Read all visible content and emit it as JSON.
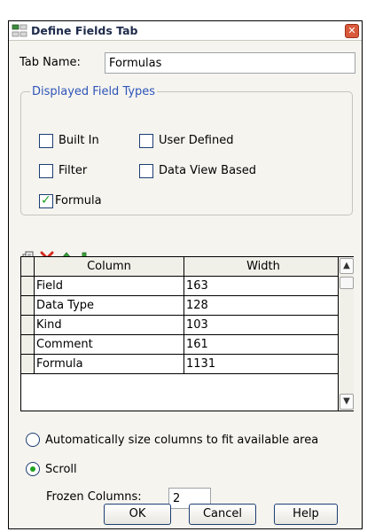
{
  "window": {
    "title": "Define Fields Tab",
    "close_glyph": "✕"
  },
  "tab_name": {
    "label": "Tab Name:",
    "value": "Formulas"
  },
  "field_types": {
    "legend": "Displayed Field Types",
    "options": [
      {
        "label": "Built In",
        "checked": false
      },
      {
        "label": "User Defined",
        "checked": false
      },
      {
        "label": "Filter",
        "checked": false
      },
      {
        "label": "Data View Based",
        "checked": false
      },
      {
        "label": "Formula",
        "checked": true
      }
    ]
  },
  "toolbar": {
    "icons": [
      "properties-icon",
      "delete-icon",
      "move-up-icon",
      "move-down-icon"
    ]
  },
  "grid": {
    "columns": [
      "Column",
      "Width"
    ],
    "rows": [
      [
        "Field",
        "163"
      ],
      [
        "Data Type",
        "128"
      ],
      [
        "Kind",
        "103"
      ],
      [
        "Comment",
        "161"
      ],
      [
        "Formula",
        "1131"
      ]
    ]
  },
  "sizing": {
    "auto_label": "Automatically size columns to fit available area",
    "scroll_label": "Scroll",
    "selected": "scroll",
    "frozen_label": "Frozen Columns:",
    "frozen_value": "2"
  },
  "buttons": {
    "ok": "OK",
    "cancel": "Cancel",
    "help": "Help"
  },
  "colors": {
    "accent_check": "#21a121",
    "legend_blue": "#2e55b8",
    "close_red": "#d85a3c"
  }
}
